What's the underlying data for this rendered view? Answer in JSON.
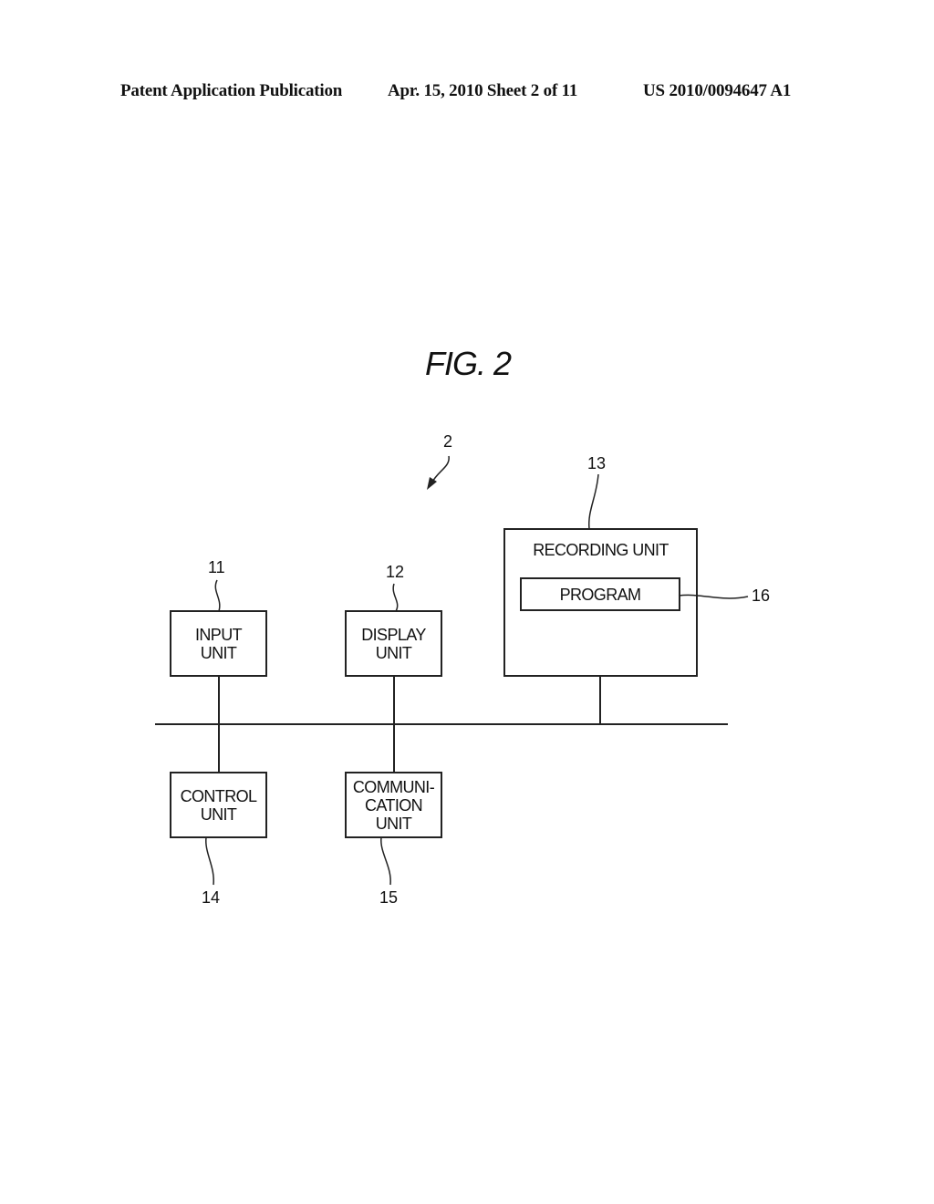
{
  "header": {
    "publication": "Patent Application Publication",
    "date_sheet": "Apr. 15, 2010  Sheet 2 of 11",
    "patent_number": "US 2010/0094647 A1"
  },
  "figure": {
    "title": "FIG. 2",
    "system_ref": "2",
    "blocks": [
      {
        "ref": "11",
        "lines": [
          "INPUT",
          "UNIT"
        ]
      },
      {
        "ref": "12",
        "lines": [
          "DISPLAY",
          "UNIT"
        ]
      },
      {
        "ref": "13",
        "lines": [
          "RECORDING UNIT"
        ]
      },
      {
        "ref": "14",
        "lines": [
          "CONTROL",
          "UNIT"
        ]
      },
      {
        "ref": "15",
        "lines": [
          "COMMUNI-",
          "CATION",
          "UNIT"
        ]
      },
      {
        "ref": "16",
        "lines": [
          "PROGRAM"
        ]
      }
    ]
  }
}
